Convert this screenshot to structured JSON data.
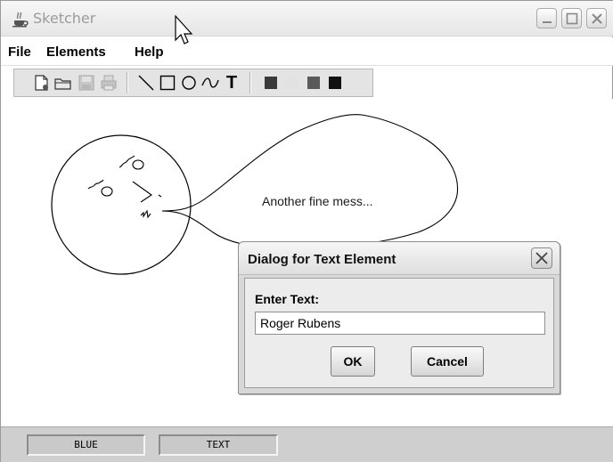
{
  "window": {
    "title": "Sketcher"
  },
  "menubar": {
    "items": [
      {
        "label": "File"
      },
      {
        "label": "Elements"
      },
      {
        "label": "Help"
      }
    ]
  },
  "toolbar": {
    "buttons": [
      {
        "icon": "new-file-icon",
        "enabled": true
      },
      {
        "icon": "open-file-icon",
        "enabled": true
      },
      {
        "icon": "save-icon",
        "enabled": false
      },
      {
        "icon": "print-icon",
        "enabled": false
      },
      {
        "icon": "line-tool-icon",
        "enabled": true
      },
      {
        "icon": "rectangle-tool-icon",
        "enabled": true
      },
      {
        "icon": "circle-tool-icon",
        "enabled": true
      },
      {
        "icon": "curve-tool-icon",
        "enabled": true
      },
      {
        "icon": "text-tool-icon",
        "label": "T",
        "enabled": true
      },
      {
        "icon": "red-color-icon",
        "color": "#3a3a3a",
        "enabled": true
      },
      {
        "icon": "yellow-color-icon",
        "color": "#e2e2e2",
        "enabled": true
      },
      {
        "icon": "green-color-icon",
        "color": "#5a5a5a",
        "enabled": true
      },
      {
        "icon": "blue-color-icon",
        "color": "#111111",
        "enabled": true
      }
    ]
  },
  "canvas": {
    "text": "Another fine mess..."
  },
  "statusbar": {
    "color": "BLUE",
    "element_type": "TEXT"
  },
  "dialog": {
    "title": "Dialog for Text Element",
    "prompt": "Enter Text:",
    "input_value": "Roger Rubens",
    "ok_label": "OK",
    "cancel_label": "Cancel"
  }
}
